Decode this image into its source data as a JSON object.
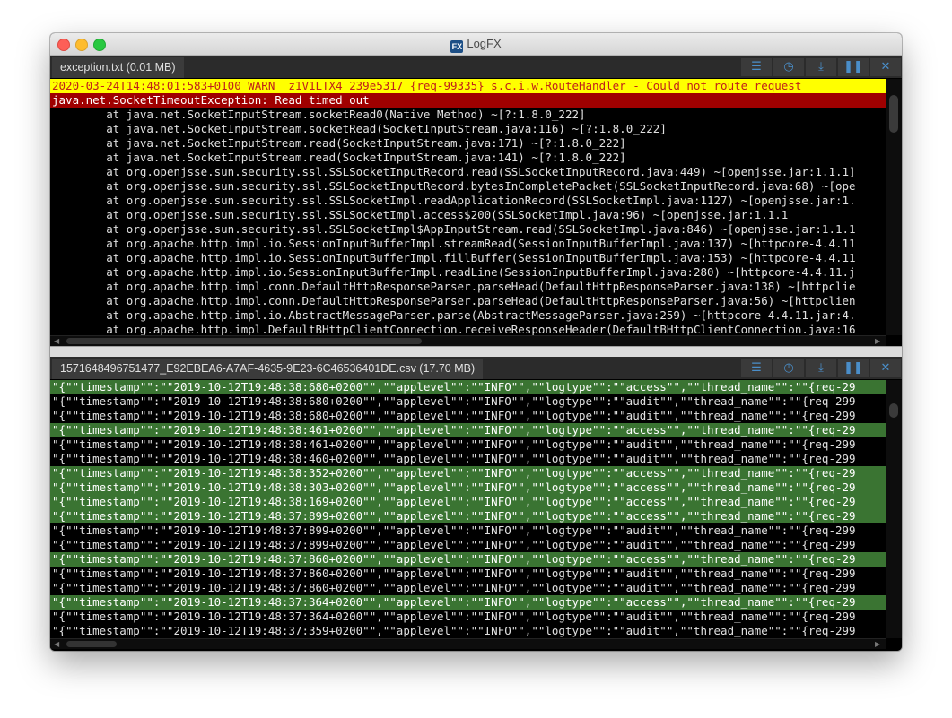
{
  "window": {
    "title": "LogFX",
    "app_icon_text": "FX"
  },
  "icons": {
    "menu": "hamburger-menu-icon",
    "clock": "clock-icon",
    "download": "download-icon",
    "pause": "pause-icon",
    "close": "close-icon"
  },
  "colors": {
    "warn_bg": "#ffff00",
    "warn_text": "#c0201a",
    "error_bg": "#9f0000",
    "highlight_green": "#3a7432",
    "toolbar_icon": "#4a8ec9"
  },
  "panes": [
    {
      "tab_label": "exception.txt (0.01 MB)",
      "lines": [
        {
          "style": "warn",
          "text": "2020-03-24T14:48:01:583+0100 WARN  z1V1LTX4 239e5317 {req-99335} s.c.i.w.RouteHandler - Could not route request"
        },
        {
          "style": "error",
          "text": "java.net.SocketTimeoutException: Read timed out"
        },
        {
          "style": "plain",
          "text": "\tat java.net.SocketInputStream.socketRead0(Native Method) ~[?:1.8.0_222]"
        },
        {
          "style": "plain",
          "text": "\tat java.net.SocketInputStream.socketRead(SocketInputStream.java:116) ~[?:1.8.0_222]"
        },
        {
          "style": "plain",
          "text": "\tat java.net.SocketInputStream.read(SocketInputStream.java:171) ~[?:1.8.0_222]"
        },
        {
          "style": "plain",
          "text": "\tat java.net.SocketInputStream.read(SocketInputStream.java:141) ~[?:1.8.0_222]"
        },
        {
          "style": "plain",
          "text": "\tat org.openjsse.sun.security.ssl.SSLSocketInputRecord.read(SSLSocketInputRecord.java:449) ~[openjsse.jar:1.1.1]"
        },
        {
          "style": "plain",
          "text": "\tat org.openjsse.sun.security.ssl.SSLSocketInputRecord.bytesInCompletePacket(SSLSocketInputRecord.java:68) ~[ope"
        },
        {
          "style": "plain",
          "text": "\tat org.openjsse.sun.security.ssl.SSLSocketImpl.readApplicationRecord(SSLSocketImpl.java:1127) ~[openjsse.jar:1."
        },
        {
          "style": "plain",
          "text": "\tat org.openjsse.sun.security.ssl.SSLSocketImpl.access$200(SSLSocketImpl.java:96) ~[openjsse.jar:1.1.1"
        },
        {
          "style": "plain",
          "text": "\tat org.openjsse.sun.security.ssl.SSLSocketImpl$AppInputStream.read(SSLSocketImpl.java:846) ~[openjsse.jar:1.1.1"
        },
        {
          "style": "plain",
          "text": "\tat org.apache.http.impl.io.SessionInputBufferImpl.streamRead(SessionInputBufferImpl.java:137) ~[httpcore-4.4.11"
        },
        {
          "style": "plain",
          "text": "\tat org.apache.http.impl.io.SessionInputBufferImpl.fillBuffer(SessionInputBufferImpl.java:153) ~[httpcore-4.4.11"
        },
        {
          "style": "plain",
          "text": "\tat org.apache.http.impl.io.SessionInputBufferImpl.readLine(SessionInputBufferImpl.java:280) ~[httpcore-4.4.11.j"
        },
        {
          "style": "plain",
          "text": "\tat org.apache.http.impl.conn.DefaultHttpResponseParser.parseHead(DefaultHttpResponseParser.java:138) ~[httpclie"
        },
        {
          "style": "plain",
          "text": "\tat org.apache.http.impl.conn.DefaultHttpResponseParser.parseHead(DefaultHttpResponseParser.java:56) ~[httpclien"
        },
        {
          "style": "plain",
          "text": "\tat org.apache.http.impl.io.AbstractMessageParser.parse(AbstractMessageParser.java:259) ~[httpcore-4.4.11.jar:4."
        },
        {
          "style": "plain",
          "text": "\tat org.apache.http.impl.DefaultBHttpClientConnection.receiveResponseHeader(DefaultBHttpClientConnection.java:16"
        }
      ]
    },
    {
      "tab_label": "1571648496751477_E92EBEA6-A7AF-4635-9E23-6C46536401DE.csv (17.70 MB)",
      "lines": [
        {
          "style": "green",
          "text": "\"{\"\"timestamp\"\":\"\"2019-10-12T19:48:38:680+0200\"\",\"\"applevel\"\":\"\"INFO\"\",\"\"logtype\"\":\"\"access\"\",\"\"thread_name\"\":\"\"{req-29"
        },
        {
          "style": "plain",
          "text": "\"{\"\"timestamp\"\":\"\"2019-10-12T19:48:38:680+0200\"\",\"\"applevel\"\":\"\"INFO\"\",\"\"logtype\"\":\"\"audit\"\",\"\"thread_name\"\":\"\"{req-299"
        },
        {
          "style": "plain",
          "text": "\"{\"\"timestamp\"\":\"\"2019-10-12T19:48:38:680+0200\"\",\"\"applevel\"\":\"\"INFO\"\",\"\"logtype\"\":\"\"audit\"\",\"\"thread_name\"\":\"\"{req-299"
        },
        {
          "style": "green",
          "text": "\"{\"\"timestamp\"\":\"\"2019-10-12T19:48:38:461+0200\"\",\"\"applevel\"\":\"\"INFO\"\",\"\"logtype\"\":\"\"access\"\",\"\"thread_name\"\":\"\"{req-29"
        },
        {
          "style": "plain",
          "text": "\"{\"\"timestamp\"\":\"\"2019-10-12T19:48:38:461+0200\"\",\"\"applevel\"\":\"\"INFO\"\",\"\"logtype\"\":\"\"audit\"\",\"\"thread_name\"\":\"\"{req-299"
        },
        {
          "style": "plain",
          "text": "\"{\"\"timestamp\"\":\"\"2019-10-12T19:48:38:460+0200\"\",\"\"applevel\"\":\"\"INFO\"\",\"\"logtype\"\":\"\"audit\"\",\"\"thread_name\"\":\"\"{req-299"
        },
        {
          "style": "green",
          "text": "\"{\"\"timestamp\"\":\"\"2019-10-12T19:48:38:352+0200\"\",\"\"applevel\"\":\"\"INFO\"\",\"\"logtype\"\":\"\"access\"\",\"\"thread_name\"\":\"\"{req-29"
        },
        {
          "style": "green",
          "text": "\"{\"\"timestamp\"\":\"\"2019-10-12T19:48:38:303+0200\"\",\"\"applevel\"\":\"\"INFO\"\",\"\"logtype\"\":\"\"access\"\",\"\"thread_name\"\":\"\"{req-29"
        },
        {
          "style": "green",
          "text": "\"{\"\"timestamp\"\":\"\"2019-10-12T19:48:38:169+0200\"\",\"\"applevel\"\":\"\"INFO\"\",\"\"logtype\"\":\"\"access\"\",\"\"thread_name\"\":\"\"{req-29"
        },
        {
          "style": "green",
          "text": "\"{\"\"timestamp\"\":\"\"2019-10-12T19:48:37:899+0200\"\",\"\"applevel\"\":\"\"INFO\"\",\"\"logtype\"\":\"\"access\"\",\"\"thread_name\"\":\"\"{req-29"
        },
        {
          "style": "plain",
          "text": "\"{\"\"timestamp\"\":\"\"2019-10-12T19:48:37:899+0200\"\",\"\"applevel\"\":\"\"INFO\"\",\"\"logtype\"\":\"\"audit\"\",\"\"thread_name\"\":\"\"{req-299"
        },
        {
          "style": "plain",
          "text": "\"{\"\"timestamp\"\":\"\"2019-10-12T19:48:37:899+0200\"\",\"\"applevel\"\":\"\"INFO\"\",\"\"logtype\"\":\"\"audit\"\",\"\"thread_name\"\":\"\"{req-299"
        },
        {
          "style": "green",
          "text": "\"{\"\"timestamp\"\":\"\"2019-10-12T19:48:37:860+0200\"\",\"\"applevel\"\":\"\"INFO\"\",\"\"logtype\"\":\"\"access\"\",\"\"thread_name\"\":\"\"{req-29"
        },
        {
          "style": "plain",
          "text": "\"{\"\"timestamp\"\":\"\"2019-10-12T19:48:37:860+0200\"\",\"\"applevel\"\":\"\"INFO\"\",\"\"logtype\"\":\"\"audit\"\",\"\"thread_name\"\":\"\"{req-299"
        },
        {
          "style": "plain",
          "text": "\"{\"\"timestamp\"\":\"\"2019-10-12T19:48:37:860+0200\"\",\"\"applevel\"\":\"\"INFO\"\",\"\"logtype\"\":\"\"audit\"\",\"\"thread_name\"\":\"\"{req-299"
        },
        {
          "style": "green",
          "text": "\"{\"\"timestamp\"\":\"\"2019-10-12T19:48:37:364+0200\"\",\"\"applevel\"\":\"\"INFO\"\",\"\"logtype\"\":\"\"access\"\",\"\"thread_name\"\":\"\"{req-29"
        },
        {
          "style": "plain",
          "text": "\"{\"\"timestamp\"\":\"\"2019-10-12T19:48:37:364+0200\"\",\"\"applevel\"\":\"\"INFO\"\",\"\"logtype\"\":\"\"audit\"\",\"\"thread_name\"\":\"\"{req-299"
        },
        {
          "style": "plain",
          "text": "\"{\"\"timestamp\"\":\"\"2019-10-12T19:48:37:359+0200\"\",\"\"applevel\"\":\"\"INFO\"\",\"\"logtype\"\":\"\"audit\"\",\"\"thread_name\"\":\"\"{req-299"
        }
      ]
    }
  ]
}
